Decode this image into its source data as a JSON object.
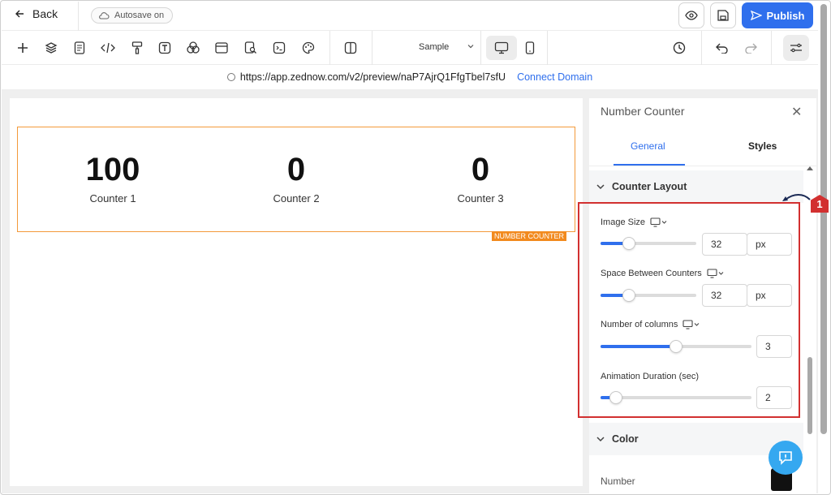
{
  "topbar": {
    "back_label": "Back",
    "autosave_label": "Autosave on",
    "publish_label": "Publish"
  },
  "toolbar": {
    "page_select_value": "Sample",
    "icons": [
      "plus-icon",
      "layers-icon",
      "page-icon",
      "code-icon",
      "paint-roller-icon",
      "text-icon",
      "circles-icon",
      "browser-icon",
      "search-doc-icon",
      "terminal-icon",
      "palette-icon",
      "columns-icon",
      "desktop-icon",
      "mobile-icon",
      "history-icon",
      "undo-icon",
      "redo-icon",
      "settings-sliders-icon"
    ]
  },
  "urlbar": {
    "url": "https://app.zednow.com/v2/preview/naP7AjrQ1FfgTbel7sfU",
    "connect_label": "Connect Domain"
  },
  "canvas": {
    "counters": [
      {
        "value": "100",
        "label": "Counter 1"
      },
      {
        "value": "0",
        "label": "Counter 2"
      },
      {
        "value": "0",
        "label": "Counter 3"
      }
    ],
    "element_tag": "NUMBER COUNTER"
  },
  "panel": {
    "title": "Number Counter",
    "tabs": [
      "General",
      "Styles"
    ],
    "active_tab": "General",
    "section_layout": "Counter Layout",
    "fields": [
      {
        "label": "Image Size",
        "value": "32",
        "unit": "px",
        "fill_fraction": 0.3
      },
      {
        "label": "Space Between Counters",
        "value": "32",
        "unit": "px",
        "fill_fraction": 0.3
      },
      {
        "label": "Number of columns",
        "value": "3",
        "fill_fraction": 0.5
      },
      {
        "label": "Animation Duration (sec)",
        "value": "2",
        "fill_fraction": 0.1
      }
    ],
    "section_color": "Color",
    "color_sub_label": "Number"
  },
  "annotation": {
    "marker": "1"
  },
  "colors": {
    "accent": "#2f6fed",
    "highlight": "#d23030",
    "element_border": "#f39a3a"
  }
}
